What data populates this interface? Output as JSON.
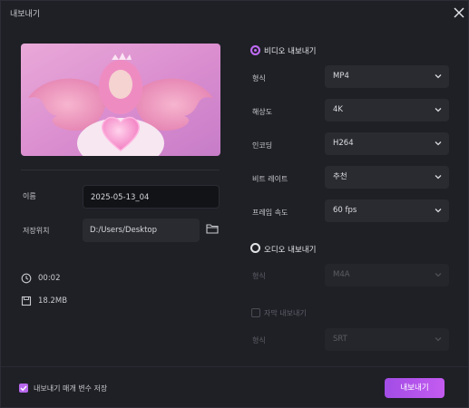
{
  "window": {
    "title": "내보내기"
  },
  "left": {
    "name_label": "이름",
    "name_value": "2025-05-13_04",
    "location_label": "저장위치",
    "location_value": "D:/Users/Desktop",
    "duration": "00:02",
    "size": "18.2MB"
  },
  "video": {
    "section_label": "비디오 내보내기",
    "selected": true,
    "rows": [
      {
        "label": "형식",
        "value": "MP4"
      },
      {
        "label": "해상도",
        "value": "4K"
      },
      {
        "label": "인코딩",
        "value": "H264"
      },
      {
        "label": "비트 레이트",
        "value": "추천"
      },
      {
        "label": "프레임 속도",
        "value": "60  fps"
      }
    ]
  },
  "audio": {
    "section_label": "오디오 내보내기",
    "selected": false,
    "format_label": "형식",
    "format_value": "M4A"
  },
  "subtitle": {
    "checkbox_label": "자막 내보내기",
    "checked": false,
    "format_label": "형식",
    "format_value": "SRT"
  },
  "footer": {
    "save_params_label": "내보내기 매개 변수 저장",
    "save_params_checked": true,
    "export_button": "내보내기"
  },
  "colors": {
    "accent": "#b867ee",
    "background": "#1f2026",
    "field": "#2a2b31"
  }
}
